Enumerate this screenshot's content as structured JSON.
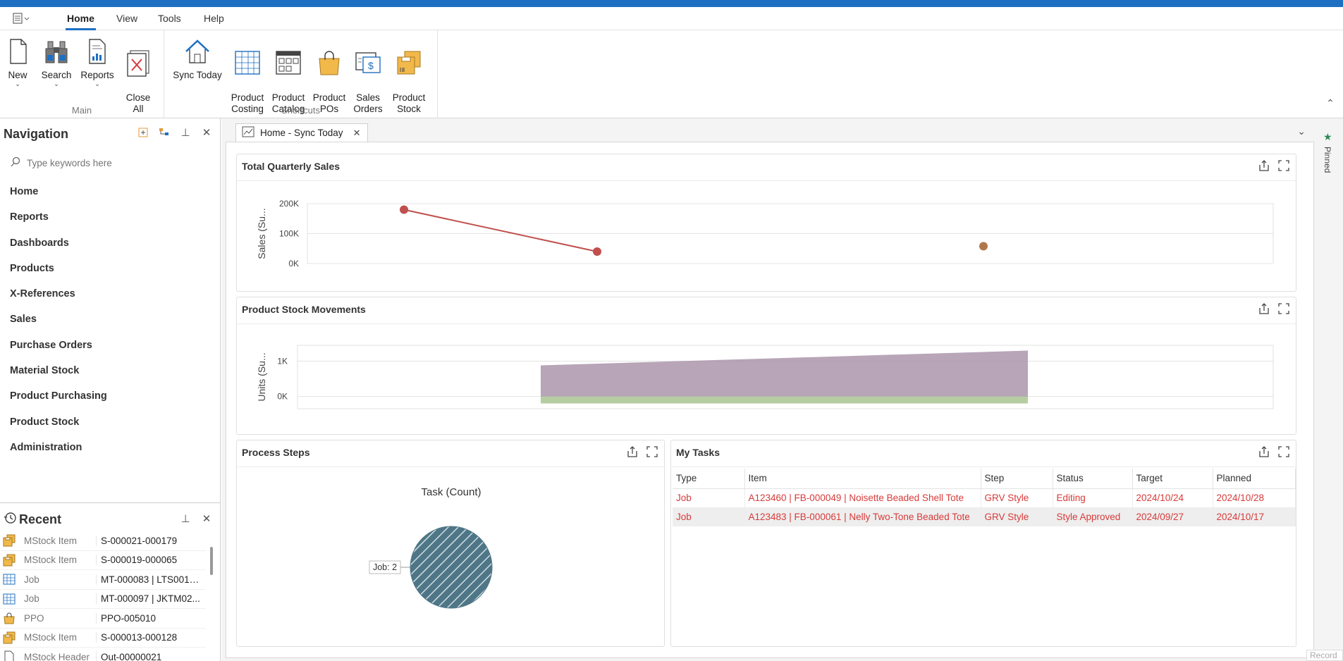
{
  "ribbon_tabs": [
    "Home",
    "View",
    "Tools",
    "Help"
  ],
  "app_menu_icon": "app-menu-icon",
  "groups": {
    "main": {
      "label": "Main",
      "buttons": [
        {
          "label": "New",
          "icon": "new-document-icon",
          "dropdown": true
        },
        {
          "label": "Search",
          "icon": "binoculars-icon",
          "dropdown": true
        },
        {
          "label": "Reports",
          "icon": "report-icon",
          "dropdown": true
        },
        {
          "label": "Close\nAll",
          "icon": "close-all-icon",
          "dropdown": false
        }
      ]
    },
    "shortcuts": {
      "label": "Shortcuts",
      "buttons": [
        {
          "label": "Sync Today",
          "icon": "home-icon"
        },
        {
          "label": "Product\nCosting",
          "icon": "grid-icon"
        },
        {
          "label": "Product\nCatalog",
          "icon": "catalog-icon"
        },
        {
          "label": "Product\nPOs",
          "icon": "shopping-bag-icon"
        },
        {
          "label": "Sales\nOrders",
          "icon": "sales-order-icon"
        },
        {
          "label": "Product\nStock",
          "icon": "stock-box-icon"
        }
      ]
    }
  },
  "navigation": {
    "title": "Navigation",
    "search_placeholder": "Type keywords here",
    "items": [
      "Home",
      "Reports",
      "Dashboards",
      "Products",
      "X-References",
      "Sales",
      "Purchase Orders",
      "Material Stock",
      "Product Purchasing",
      "Product Stock",
      "Administration"
    ]
  },
  "recent": {
    "title": "Recent",
    "rows": [
      {
        "type": "MStock Item",
        "value": "S-000021-000179",
        "icon": "stock-box-icon"
      },
      {
        "type": "MStock Item",
        "value": "S-000019-000065",
        "icon": "stock-box-icon"
      },
      {
        "type": "Job",
        "value": "MT-000083 | LTS0010...",
        "icon": "grid-icon"
      },
      {
        "type": "Job",
        "value": "MT-000097 | JKTM02...",
        "icon": "grid-icon"
      },
      {
        "type": "PPO",
        "value": "PPO-005010",
        "icon": "shopping-bag-icon"
      },
      {
        "type": "MStock Item",
        "value": "S-000013-000128",
        "icon": "stock-box-icon"
      },
      {
        "type": "MStock Header",
        "value": "Out-00000021",
        "icon": "document-icon"
      }
    ]
  },
  "doc_tab": {
    "label": "Home - Sync Today",
    "icon": "dashboard-icon"
  },
  "pinned_label": "Pinned",
  "record_label": "Record",
  "cards": {
    "sales": {
      "title": "Total Quarterly Sales"
    },
    "stock": {
      "title": "Product Stock Movements"
    },
    "process": {
      "title": "Process Steps"
    },
    "tasks": {
      "title": "My Tasks"
    }
  },
  "chart_data": [
    {
      "type": "line",
      "title": "Total Quarterly Sales",
      "ylabel": "Sales (Su...",
      "yticks": [
        "0K",
        "100K",
        "200K"
      ],
      "ylim": [
        0,
        200000
      ],
      "grid": true,
      "series": [
        {
          "values": [
            {
              "x": 1,
              "y": 180000
            },
            {
              "x": 2,
              "y": 40000
            }
          ],
          "color": "#c0504d"
        },
        {
          "values": [
            {
              "x": 4,
              "y": 58000
            }
          ],
          "color": "#b0784a"
        }
      ],
      "xlim": [
        0.5,
        5.5
      ]
    },
    {
      "type": "area",
      "title": "Product Stock Movements",
      "ylabel": "Units (Su...",
      "yticks": [
        "0K",
        "1K"
      ],
      "ylim": [
        -350,
        1450
      ],
      "grid": true,
      "series": [
        {
          "values": [
            880,
            1300
          ],
          "color": "#a68ea6"
        },
        {
          "values": [
            -200,
            -200
          ],
          "color": "#a4c08a"
        }
      ]
    },
    {
      "type": "pie",
      "title": "Task (Count)",
      "slices": [
        {
          "label": "Job",
          "value": 2,
          "color": "#4f7686"
        }
      ],
      "data_labels": [
        "Job: 2"
      ]
    }
  ],
  "tasks": {
    "columns": [
      "Type",
      "Item",
      "Step",
      "Status",
      "Target",
      "Planned"
    ],
    "rows": [
      [
        "Job",
        "A123460 | FB-000049 | Noisette Beaded Shell Tote",
        "GRV Style",
        "Editing",
        "2024/10/24",
        "2024/10/28"
      ],
      [
        "Job",
        "A123483 | FB-000061 | Nelly Two-Tone Beaded Tote",
        "GRV Style",
        "Style Approved",
        "2024/09/27",
        "2024/10/17"
      ]
    ],
    "row_color": "#d83a3a"
  },
  "colors": {
    "accent": "#1e6fc2"
  }
}
